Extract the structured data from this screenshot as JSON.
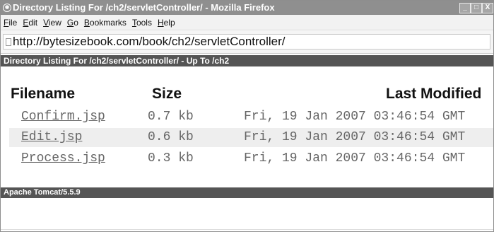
{
  "window": {
    "title": "Directory Listing For /ch2/servletController/ - Mozilla Firefox",
    "app_icon": "firefox-icon",
    "controls": {
      "minimize": "_",
      "maximize": "□",
      "close": "X"
    }
  },
  "menu": {
    "items": [
      "File",
      "Edit",
      "View",
      "Go",
      "Bookmarks",
      "Tools",
      "Help"
    ]
  },
  "address": {
    "url": "http://bytesizebook.com/book/ch2/servletController/",
    "page_icon": "page-icon"
  },
  "listing": {
    "heading_prefix": "Directory Listing For /ch2/servletController/ - ",
    "heading_link": "Up To /ch2",
    "columns": {
      "filename": "Filename",
      "size": "Size",
      "last_modified": "Last Modified"
    },
    "rows": [
      {
        "name": "Confirm.jsp",
        "size": "0.7 kb",
        "modified": "Fri, 19 Jan 2007 03:46:54 GMT"
      },
      {
        "name": "Edit.jsp",
        "size": "0.6 kb",
        "modified": "Fri, 19 Jan 2007 03:46:54 GMT"
      },
      {
        "name": "Process.jsp",
        "size": "0.3 kb",
        "modified": "Fri, 19 Jan 2007 03:46:54 GMT"
      }
    ]
  },
  "footer": {
    "text": "Apache Tomcat/5.5.9"
  },
  "colors": {
    "title_bar": "#8f8f8f",
    "header_bar": "#555555",
    "row_alt": "#eeeeee",
    "text": "#111111",
    "muted_text": "#666666"
  }
}
